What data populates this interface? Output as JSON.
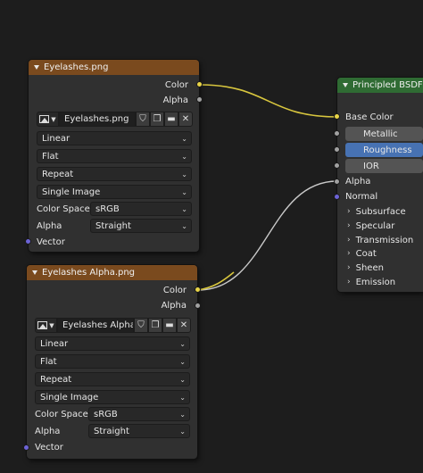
{
  "node1": {
    "title": "Eyelashes.png",
    "outputs": {
      "color": "Color",
      "alpha": "Alpha"
    },
    "image_name": "Eyelashes.png",
    "interpolation": "Linear",
    "projection": "Flat",
    "extension": "Repeat",
    "source": "Single Image",
    "color_space_label": "Color Space",
    "color_space": "sRGB",
    "alpha_label": "Alpha",
    "alpha_mode": "Straight",
    "vector_input": "Vector"
  },
  "node2": {
    "title": "Eyelashes Alpha.png",
    "outputs": {
      "color": "Color",
      "alpha": "Alpha"
    },
    "image_name": "Eyelashes Alpha...",
    "interpolation": "Linear",
    "projection": "Flat",
    "extension": "Repeat",
    "source": "Single Image",
    "color_space_label": "Color Space",
    "color_space": "sRGB",
    "alpha_label": "Alpha",
    "alpha_mode": "Straight",
    "vector_input": "Vector"
  },
  "bsdf": {
    "title": "Principled BSDF",
    "base_color": "Base Color",
    "metallic": "Metallic",
    "roughness": "Roughness",
    "ior": "IOR",
    "alpha": "Alpha",
    "normal": "Normal",
    "panels": [
      "Subsurface",
      "Specular",
      "Transmission",
      "Coat",
      "Sheen",
      "Emission"
    ]
  },
  "colors": {
    "color_socket": "#e8d447",
    "float_socket": "#a1a1a1",
    "vector_socket": "#6c63d6",
    "texture_header": "#7a4a1e",
    "shader_header": "#2f6b33",
    "active_field": "#4772b3"
  },
  "icons": {
    "image_type": "image-icon",
    "fake_user": "shield-icon",
    "duplicate": "duplicate-icon",
    "open": "folder-icon",
    "unlink": "close-icon"
  }
}
